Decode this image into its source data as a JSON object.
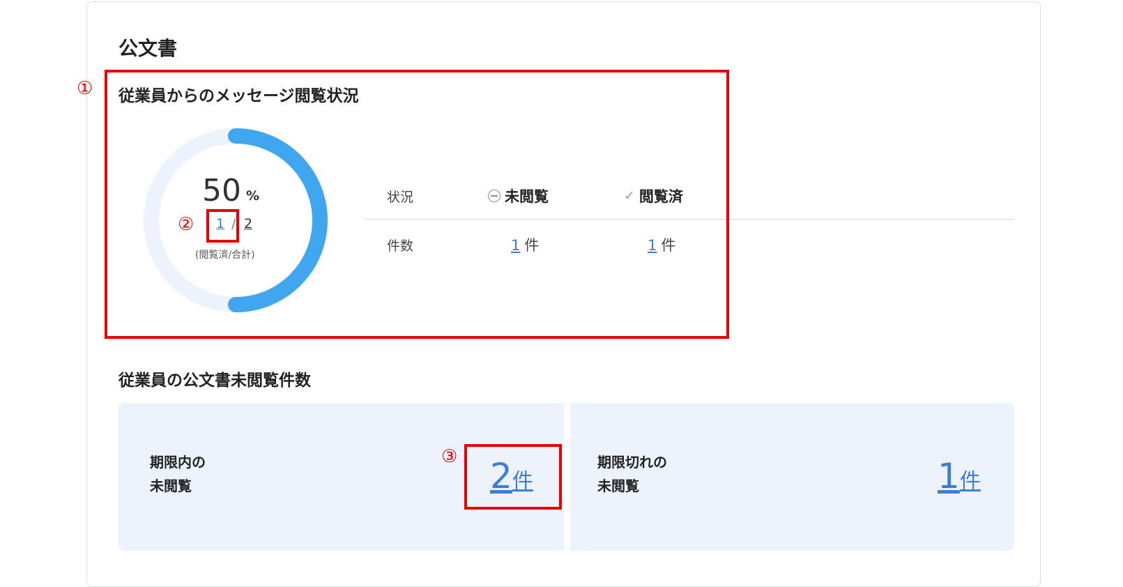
{
  "page_title": "公文書",
  "message_status": {
    "title": "従業員からのメッセージ閲覧状況",
    "percent": "50",
    "percent_unit": "%",
    "read_count": "1",
    "total_count": "2",
    "separator": "/",
    "caption": "(閲覧済/合計)",
    "progress_fraction": 0.5,
    "colors": {
      "progress": "#3fa6ef",
      "track": "#ecf3fc"
    },
    "table": {
      "header_label": "状況",
      "unread_label": "未閲覧",
      "read_label": "閲覧済",
      "row_label": "件数",
      "unread_count": "1",
      "read_count": "1",
      "unit": "件"
    }
  },
  "unread_docs": {
    "title": "従業員の公文書未閲覧件数",
    "within_deadline": {
      "label_line1": "期限内の",
      "label_line2": "未閲覧",
      "count": "2",
      "unit": "件"
    },
    "overdue": {
      "label_line1": "期限切れの",
      "label_line2": "未閲覧",
      "count": "1",
      "unit": "件"
    }
  },
  "annotations": {
    "marker1": "①",
    "marker2": "②",
    "marker3": "③",
    "color": "#e60000"
  },
  "icons": {
    "unread": "minus-circle-icon",
    "read": "check-icon"
  }
}
